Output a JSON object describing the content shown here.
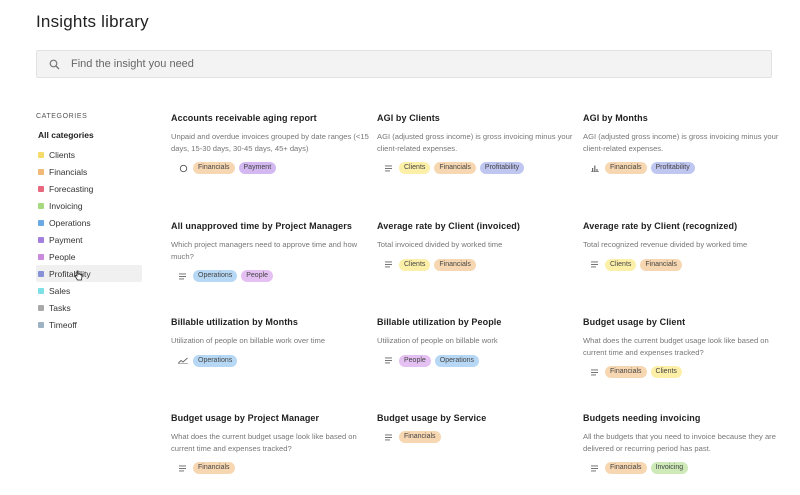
{
  "page": {
    "title": "Insights library"
  },
  "search": {
    "placeholder": "Find the insight you need"
  },
  "sidebar": {
    "heading": "CATEGORIES",
    "all_label": "All categories",
    "items": [
      {
        "label": "Clients",
        "color": "#f5dc6a"
      },
      {
        "label": "Financials",
        "color": "#f1b877"
      },
      {
        "label": "Forecasting",
        "color": "#e8677f"
      },
      {
        "label": "Invoicing",
        "color": "#a6d880"
      },
      {
        "label": "Operations",
        "color": "#6aa9e4"
      },
      {
        "label": "Payment",
        "color": "#a57fe0"
      },
      {
        "label": "People",
        "color": "#c98ade"
      },
      {
        "label": "Profitability",
        "color": "#8791d6"
      },
      {
        "label": "Sales",
        "color": "#7ddfe8"
      },
      {
        "label": "Tasks",
        "color": "#a9a9a9"
      },
      {
        "label": "Timeoff",
        "color": "#9db2c2"
      }
    ]
  },
  "cards": [
    {
      "title": "Accounts receivable aging report",
      "desc": "Unpaid and overdue invoices grouped by date ranges (<15 days, 15-30 days, 30-45 days, 45+ days)",
      "icon": "circle-icon",
      "tags": [
        "Financials",
        "Payment"
      ]
    },
    {
      "title": "AGI by Clients",
      "desc": "AGI (adjusted gross income) is gross invoicing minus your client-related expenses.",
      "icon": "list-icon",
      "tags": [
        "Clients",
        "Financials",
        "Profitability"
      ]
    },
    {
      "title": "AGI by Months",
      "desc": "AGI (adjusted gross income) is gross invoicing minus your client-related expenses.",
      "icon": "bar-chart-icon",
      "tags": [
        "Financials",
        "Profitability"
      ]
    },
    {
      "title": "All unapproved time by Project Managers",
      "desc": "Which project managers need to approve time and how much?",
      "icon": "list-icon",
      "tags": [
        "Operations",
        "People"
      ]
    },
    {
      "title": "Average rate by Client (invoiced)",
      "desc": "Total invoiced divided by worked time",
      "icon": "list-icon",
      "tags": [
        "Clients",
        "Financials"
      ]
    },
    {
      "title": "Average rate by Client (recognized)",
      "desc": "Total recognized revenue divided by worked time",
      "icon": "list-icon",
      "tags": [
        "Clients",
        "Financials"
      ]
    },
    {
      "title": "Billable utilization by Months",
      "desc": "Utilization of people on billable work over time",
      "icon": "line-chart-icon",
      "tags": [
        "Operations"
      ]
    },
    {
      "title": "Billable utilization by People",
      "desc": "Utilization of people on billable work",
      "icon": "list-icon",
      "tags": [
        "People",
        "Operations"
      ]
    },
    {
      "title": "Budget usage by Client",
      "desc": "What does the current budget usage look like based on current time and expenses tracked?",
      "icon": "list-icon",
      "tags": [
        "Financials",
        "Clients"
      ]
    },
    {
      "title": "Budget usage by Project Manager",
      "desc": "What does the current budget usage look like based on current time and expenses tracked?",
      "icon": "list-icon",
      "tags": [
        "Financials"
      ]
    },
    {
      "title": "Budget usage by Service",
      "desc": "",
      "icon": "list-icon",
      "tags": [
        "Financials"
      ]
    },
    {
      "title": "Budgets needing invoicing",
      "desc": "All the budgets that you need to invoice because they are delivered or recurring period has past.",
      "icon": "list-icon",
      "tags": [
        "Financials",
        "Invoicing"
      ]
    }
  ]
}
